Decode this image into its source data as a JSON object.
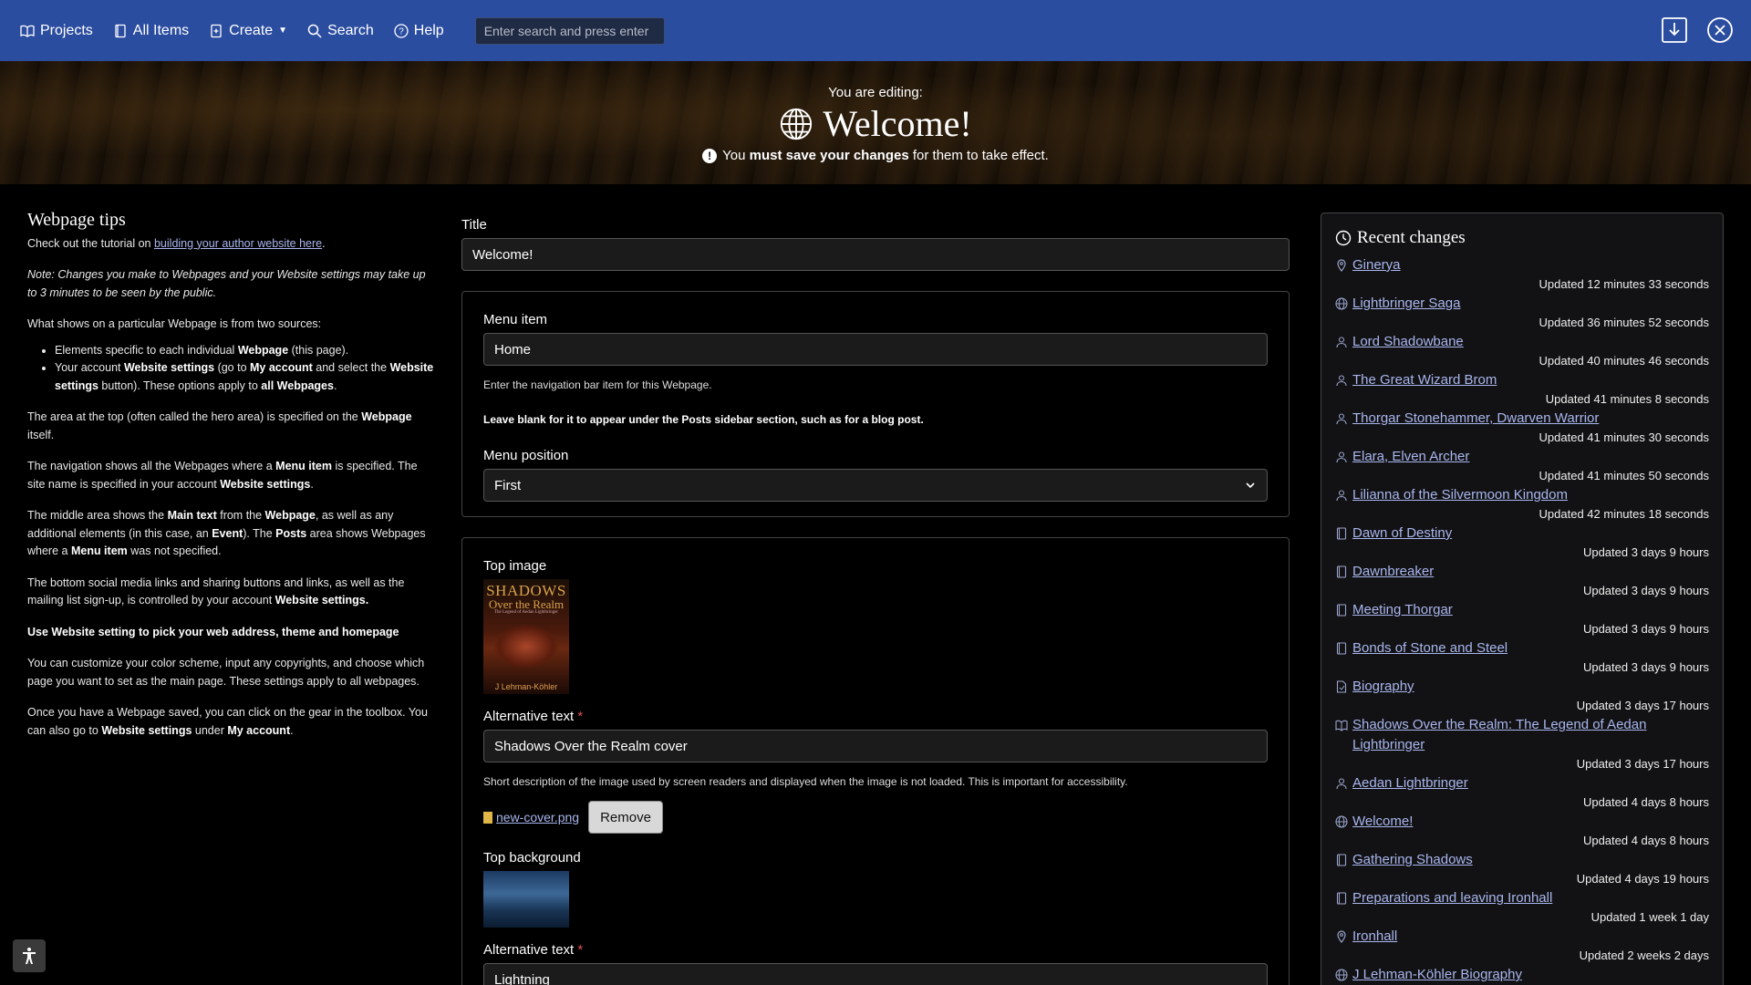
{
  "nav": {
    "projects": "Projects",
    "all_items": "All Items",
    "create": "Create",
    "search": "Search",
    "help": "Help",
    "search_placeholder": "Enter search and press enter"
  },
  "hero": {
    "editing_label": "You are editing:",
    "title": "Welcome!",
    "note_pre": "You ",
    "note_bold": "must save your changes",
    "note_post": " for them to take effect."
  },
  "tips": {
    "heading": "Webpage tips",
    "p1_pre": "Check out the tutorial on ",
    "p1_link": "building your author website here",
    "p1_post": ".",
    "note": "Note: Changes you make to Webpages and your Website settings may take up to 3 minutes to be seen by the public.",
    "p2": "What shows on a particular Webpage is from two sources:",
    "li1_pre": "Elements specific to each individual ",
    "li1_bold": "Webpage",
    "li1_post": " (this page).",
    "li2_a": "Your account ",
    "li2_b": "Website settings",
    "li2_c": " (go to ",
    "li2_d": "My account",
    "li2_e": " and select the ",
    "li2_f": "Website settings",
    "li2_g": " button). These options apply to ",
    "li2_h": "all Webpages",
    "li2_i": ".",
    "p3_a": "The area at the top (often called the hero area) is specified on the ",
    "p3_b": "Webpage",
    "p3_c": " itself.",
    "p4_a": "The navigation shows all the Webpages where a ",
    "p4_b": "Menu item",
    "p4_c": " is specified. The site name is specified in your account ",
    "p4_d": "Website settings",
    "p4_e": ".",
    "p5_a": "The middle area shows the ",
    "p5_b": "Main text",
    "p5_c": " from the ",
    "p5_d": "Webpage",
    "p5_e": ", as well as any additional elements (in this case, an ",
    "p5_f": "Event",
    "p5_g": "). The ",
    "p5_h": "Posts",
    "p5_i": " area shows Webpages where a ",
    "p5_j": "Menu item",
    "p5_k": " was not specified.",
    "p6_a": "The bottom social media links and sharing buttons and links, as well as the mailing list sign-up, is controlled by your account ",
    "p6_b": "Website settings.",
    "p7": "Use Website setting to pick your web address, theme and homepage",
    "p8": "You can customize your color scheme, input any copyrights, and choose which page you want to set as the main page. These settings apply to all webpages.",
    "p9_a": "Once you have a Webpage saved, you can click on the gear in the toolbox. You can also go to ",
    "p9_b": "Website settings",
    "p9_c": " under ",
    "p9_d": "My account",
    "p9_e": "."
  },
  "form": {
    "title_label": "Title",
    "title_value": "Welcome!",
    "menu_item_label": "Menu item",
    "menu_item_value": "Home",
    "menu_item_help": "Enter the navigation bar item for this Webpage.",
    "menu_item_help_bold": "Leave blank for it to appear under the Posts sidebar section, such as for a blog post.",
    "menu_position_label": "Menu position",
    "menu_position_value": "First",
    "top_image_label": "Top image",
    "cover_title_1": "SHADOWS",
    "cover_title_2": "Over the Realm",
    "cover_subtitle": "The Legend of Aedan Lightbringer",
    "cover_author": "J Lehman-Köhler",
    "alt_text_label": "Alternative text",
    "required_mark": "*",
    "alt_text_value": "Shadows Over the Realm cover",
    "alt_text_help": "Short description of the image used by screen readers and displayed when the image is not loaded. This is important for accessibility.",
    "file_name": "new-cover.png",
    "remove_label": "Remove",
    "top_background_label": "Top background",
    "alt_text_label_2": "Alternative text",
    "alt_text_value_2": "Lightning"
  },
  "recent": {
    "heading": "Recent changes",
    "items": [
      {
        "icon": "location-pin-icon",
        "name": "Ginerya",
        "time": "Updated 12 minutes 33 seconds"
      },
      {
        "icon": "globe-icon",
        "name": "Lightbringer Saga",
        "time": "Updated 36 minutes 52 seconds"
      },
      {
        "icon": "person-icon",
        "name": "Lord Shadowbane",
        "time": "Updated 40 minutes 46 seconds"
      },
      {
        "icon": "person-icon",
        "name": "The Great Wizard Brom",
        "time": "Updated 41 minutes 8 seconds"
      },
      {
        "icon": "person-icon",
        "name": "Thorgar Stonehammer, Dwarven Warrior",
        "time": "Updated 41 minutes 30 seconds"
      },
      {
        "icon": "person-icon",
        "name": "Elara, Elven Archer",
        "time": "Updated 41 minutes 50 seconds"
      },
      {
        "icon": "person-icon",
        "name": "Lilianna of the Silvermoon Kingdom",
        "time": "Updated 42 minutes 18 seconds"
      },
      {
        "icon": "document-icon",
        "name": "Dawn of Destiny",
        "time": "Updated 3 days 9 hours"
      },
      {
        "icon": "document-icon",
        "name": "Dawnbreaker",
        "time": "Updated 3 days 9 hours"
      },
      {
        "icon": "document-icon",
        "name": "Meeting Thorgar",
        "time": "Updated 3 days 9 hours"
      },
      {
        "icon": "document-icon",
        "name": "Bonds of Stone and Steel",
        "time": "Updated 3 days 9 hours"
      },
      {
        "icon": "page-icon",
        "name": "Biography",
        "time": "Updated 3 days 17 hours"
      },
      {
        "icon": "book-icon",
        "name": "Shadows Over the Realm: The Legend of Aedan Lightbringer",
        "time": "Updated 3 days 17 hours"
      },
      {
        "icon": "person-icon",
        "name": "Aedan Lightbringer",
        "time": "Updated 4 days 8 hours"
      },
      {
        "icon": "globe-icon",
        "name": "Welcome!",
        "time": "Updated 4 days 8 hours"
      },
      {
        "icon": "document-icon",
        "name": "Gathering Shadows",
        "time": "Updated 4 days 19 hours"
      },
      {
        "icon": "document-icon",
        "name": "Preparations and leaving Ironhall",
        "time": "Updated 1 week 1 day"
      },
      {
        "icon": "location-pin-icon",
        "name": "Ironhall",
        "time": "Updated 2 weeks 2 days"
      },
      {
        "icon": "globe-icon",
        "name": "J Lehman-Köhler Biography",
        "time": ""
      }
    ]
  },
  "colors": {
    "nav_bg": "#2b4da0",
    "link": "#a9b6ee",
    "page_bg": "#000000"
  }
}
